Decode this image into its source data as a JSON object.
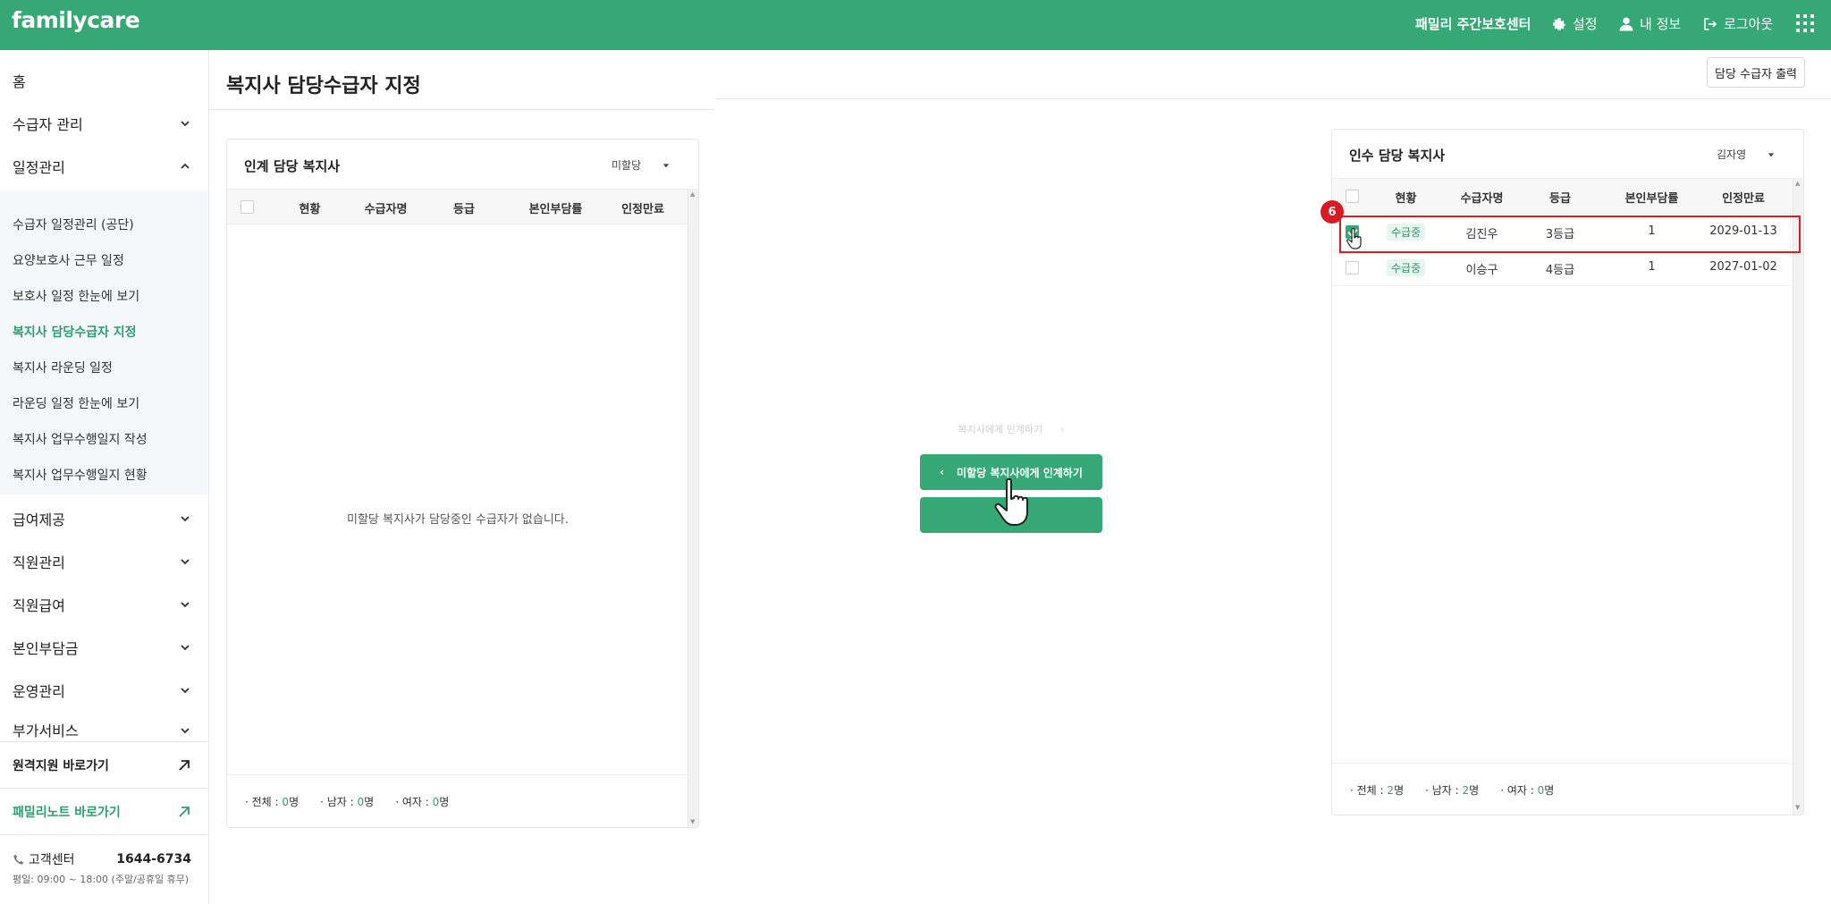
{
  "header": {
    "logo": "familycare",
    "center_name": "패밀리 주간보호센터",
    "settings": "설정",
    "my_info": "내 정보",
    "logout": "로그아웃"
  },
  "sidebar": {
    "home": "홈",
    "menu": [
      {
        "label": "수급자 관리"
      },
      {
        "label": "일정관리"
      }
    ],
    "submenu": [
      {
        "label": "수급자 일정관리 (공단)"
      },
      {
        "label": "요양보호사 근무 일정"
      },
      {
        "label": "보호사 일정 한눈에 보기"
      },
      {
        "label": "복지사 담당수급자 지정"
      },
      {
        "label": "복지사 라운딩 일정"
      },
      {
        "label": "라운딩 일정 한눈에 보기"
      },
      {
        "label": "복지사 업무수행일지 작성"
      },
      {
        "label": "복지사 업무수행일지 현황"
      }
    ],
    "menu2": [
      {
        "label": "급여제공"
      },
      {
        "label": "직원관리"
      },
      {
        "label": "직원급여"
      },
      {
        "label": "본인부담금"
      },
      {
        "label": "운영관리"
      },
      {
        "label": "부가서비스"
      }
    ],
    "remote_link": "원격지원 바로가기",
    "familynote_link": "패밀리노트 바로가기",
    "cs_label": "고객센터",
    "cs_phone": "1644-6734",
    "cs_hours": "평일: 09:00 ~ 18:00 (주말/공휴일 휴무)"
  },
  "main": {
    "title": "복지사 담당수급자 지정",
    "print_button": "담당 수급자 출력",
    "columns": [
      "현황",
      "수급자명",
      "등급",
      "본인부담률",
      "인정만료"
    ],
    "left_panel": {
      "title": "인계 담당 복지사",
      "select_value": "미할당",
      "empty_message": "미할당 복지사가 담당중인 수급자가 없습니다.",
      "stats": {
        "total_label": "전체 :",
        "total": "0",
        "male_label": "남자 :",
        "male": "0",
        "female_label": "여자 :",
        "female": "0",
        "unit": "명"
      }
    },
    "right_panel": {
      "title": "인수 담당 복지사",
      "select_value": "김자영",
      "rows": [
        {
          "status": "수급중",
          "name": "김진우",
          "grade": "3등급",
          "rate": "1",
          "expiry": "2029-01-13",
          "checked": true
        },
        {
          "status": "수급중",
          "name": "이승구",
          "grade": "4등급",
          "rate": "1",
          "expiry": "2027-01-02",
          "checked": false
        }
      ],
      "stats": {
        "total_label": "전체 :",
        "total": "2",
        "male_label": "남자 :",
        "male": "2",
        "female_label": "여자 :",
        "female": "0",
        "unit": "명"
      }
    },
    "transfer": {
      "ghost_label": "복지사에게 인계하기",
      "back_label": "미할당 복지사에게 인계하기"
    },
    "step_number": "6"
  }
}
